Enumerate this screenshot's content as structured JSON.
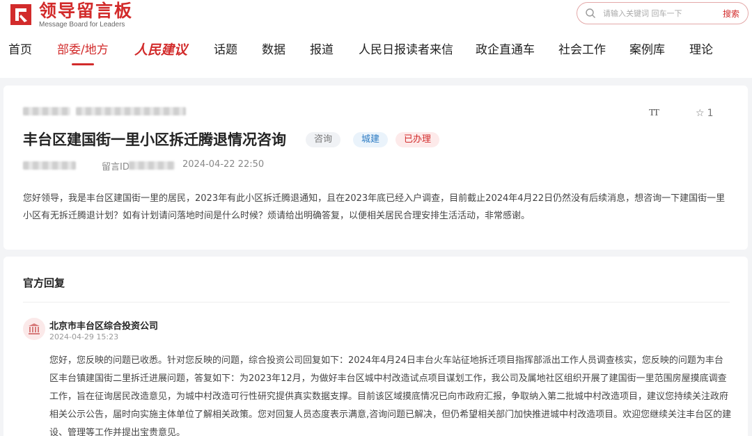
{
  "site": {
    "title": "领导留言板",
    "subtitle": "Message Board for Leaders",
    "brand_color": "#d22b2b"
  },
  "search": {
    "placeholder": "请输入关键词 回车一下",
    "button": "搜索"
  },
  "nav": {
    "items": [
      {
        "label": "首页",
        "active": false
      },
      {
        "label": "部委/地方",
        "active": true
      },
      {
        "label": "人民建议",
        "active": false
      },
      {
        "label": "话题",
        "active": false
      },
      {
        "label": "数据",
        "active": false
      },
      {
        "label": "报道",
        "active": false
      },
      {
        "label": "人民日报读者来信",
        "active": false
      },
      {
        "label": "政企直通车",
        "active": false
      },
      {
        "label": "社会工作",
        "active": false
      },
      {
        "label": "案例库",
        "active": false
      },
      {
        "label": "理论",
        "active": false
      }
    ]
  },
  "message": {
    "title": "丰台区建国街一里小区拆迁腾退情况咨询",
    "tags": [
      {
        "label": "咨询",
        "style": "gray"
      },
      {
        "label": "城建",
        "style": "blue"
      },
      {
        "label": "已办理",
        "style": "red"
      }
    ],
    "id_label": "留言ID",
    "datetime": "2024-04-22 22:50",
    "font_tool": "TT",
    "favorite_count": "1",
    "content": "您好领导，我是丰台区建国街一里的居民，2023年有此小区拆迁腾退通知，且在2023年底已经入户调查，目前截止2024年4月22日仍然没有后续消息，想咨询一下建国街一里小区有无拆迁腾退计划？如有计划请问落地时间是什么时候？烦请给出明确答复，以便相关居民合理安排生活活动，非常感谢。"
  },
  "reply": {
    "section_title": "官方回复",
    "org_name": "北京市丰台区综合投资公司",
    "datetime": "2024-04-29 15:23",
    "content": "您好，您反映的问题已收悉。针对您反映的问题，综合投资公司回复如下：2024年4月24日丰台火车站征地拆迁项目指挥部派出工作人员调查核实，您反映的问题为丰台区丰台镇建国街二里拆迁进展问题，答复如下：为2023年12月，为做好丰台区城中村改造试点项目谋划工作，我公司及属地社区组织开展了建国街一里范围房屋摸底调查工作，旨在征询居民改造意见，为城中村改造可行性研究提供真实数据支撑。目前该区域摸底情况已向市政府汇报，争取纳入第二批城中村改造项目，建议您持续关注政府相关公示公告，届时向实施主体单位了解相关政策。您对回复人员态度表示满意,咨询问题已解决，但仍希望相关部门加快推进城中村改造项目。欢迎您继续关注丰台区的建设、管理等工作并提出宝贵意见。"
  }
}
